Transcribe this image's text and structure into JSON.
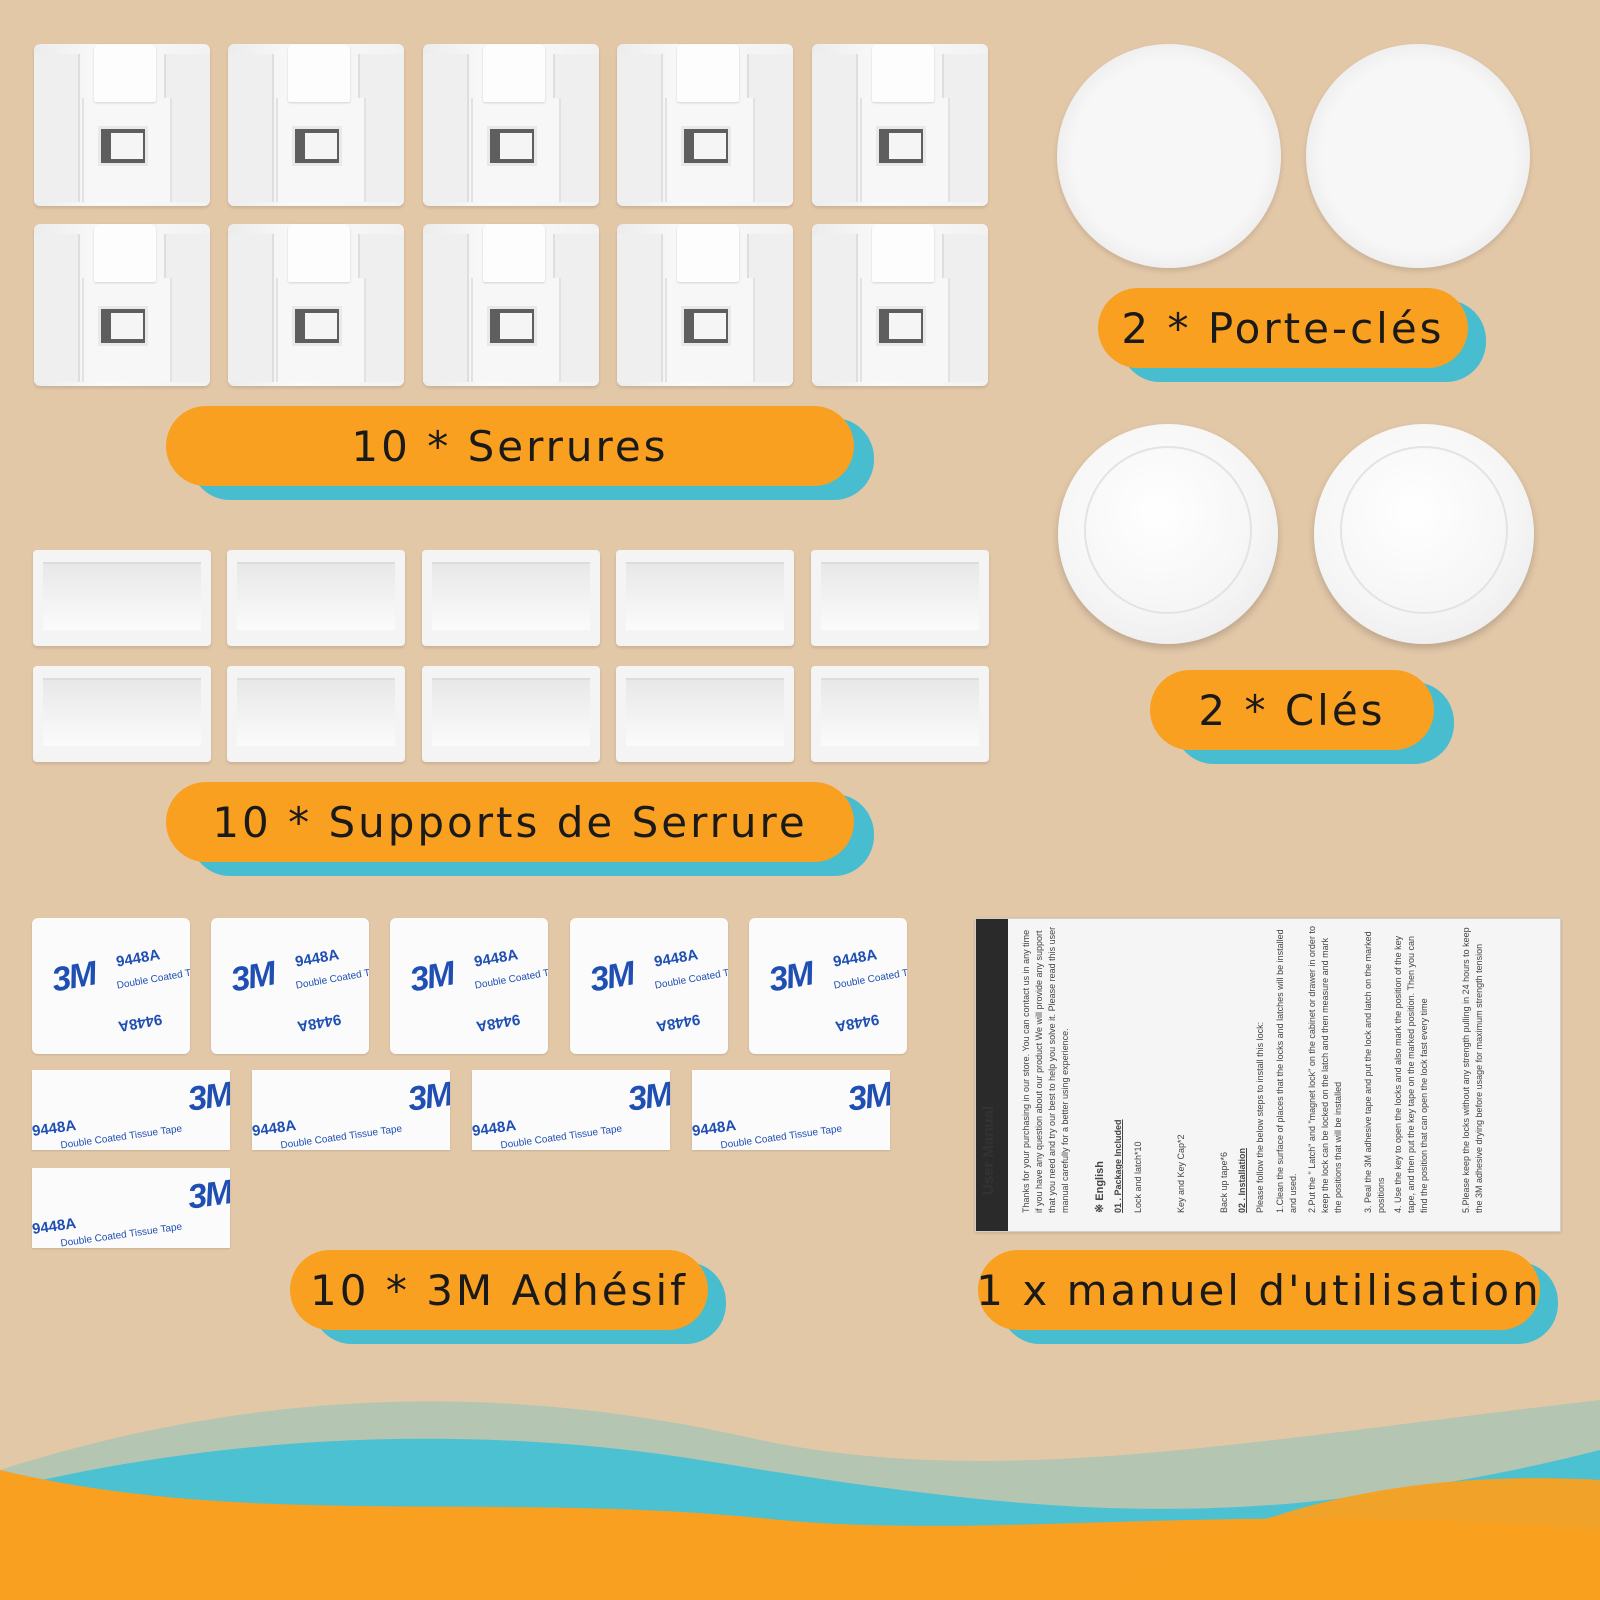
{
  "labels": {
    "locks": "10 * Serrures",
    "key_holders": "2 * Porte-clés",
    "keys": "2 * Clés",
    "lock_supports": "10 * Supports de Serrure",
    "adhesive": "10 * 3M Adhésif",
    "manual": "1 x manuel d'utilisation"
  },
  "adhesive_print": {
    "brand": "3M",
    "code": "9448A",
    "product": "Double Coated Tissue Tape"
  },
  "manual": {
    "title": "User Manual",
    "intro": "Thanks for your purchasing in our store. You can contact us in any time if you have any question about our product We will provide any support that you need and try our best to help you solve it. Please read this user manual carefully for a better using experience.",
    "language": "※ English",
    "section1": "01 . Package Included",
    "items": [
      "Lock and latch*10",
      "Key and Key Cap*2",
      "Back up tape*6"
    ],
    "section2": "02 . Installation",
    "steps_intro": "Please follow the below steps to install this lock:",
    "steps": [
      "1.Clean the surface of places that the locks and latches will be installed and used.",
      "2.Put the \" Latch\" and \"magnet lock\" on the cabinet or drawer in order to keep the lock can be locked on the latch and then measure and mark the positions that will be installed",
      "3. Peal the 3M adhesive tape and put the lock and latch on the marked positions",
      "4. Use the key to open the locks and also mark the position of the key tape, and then put the key tape on the marked position. Then you can find the position that can open the lock fast every time",
      "5.Please keep the locks without any strength pulling in 24 hours to keep the 3M adhesive drying before usage for maximum strength tension"
    ]
  },
  "colors": {
    "background": "#e3c8a8",
    "label_fill": "#f9a020",
    "label_shadow": "#48bdd0",
    "wave_orange": "#f9a020",
    "wave_teal": "#4bc1d2",
    "wave_sage": "#b4c5b2",
    "brand_blue": "#1f4fb3"
  }
}
